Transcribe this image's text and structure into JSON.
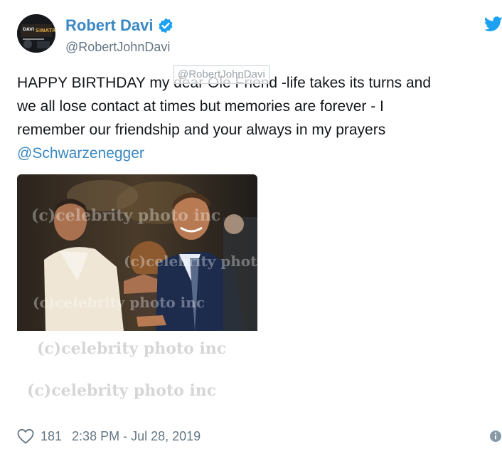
{
  "author": {
    "display_name": "Robert Davi",
    "handle": "@RobertJohnDavi",
    "verified": true
  },
  "tweet": {
    "lines": [
      "HAPPY BIRTHDAY my dear Ole Friend -life takes its turns and",
      "we all lose contact at times but memories are forever - I",
      "remember our friendship and your always in my prayers"
    ],
    "mention": "@Schwarzenegger",
    "overlay_watermark": "@RobertJohnDavi"
  },
  "media": {
    "watermark": "(c)celebrity photo inc"
  },
  "footer": {
    "likes": "181",
    "timestamp": "2:38 PM - Jul 28, 2019"
  },
  "icons": {
    "verified": "verified-badge-icon",
    "twitter": "twitter-bird-icon",
    "like": "heart-icon",
    "info": "info-icon"
  },
  "colors": {
    "link": "#3b88c3",
    "verified": "#1da1f2",
    "secondary": "#657786",
    "text": "#14171a"
  }
}
